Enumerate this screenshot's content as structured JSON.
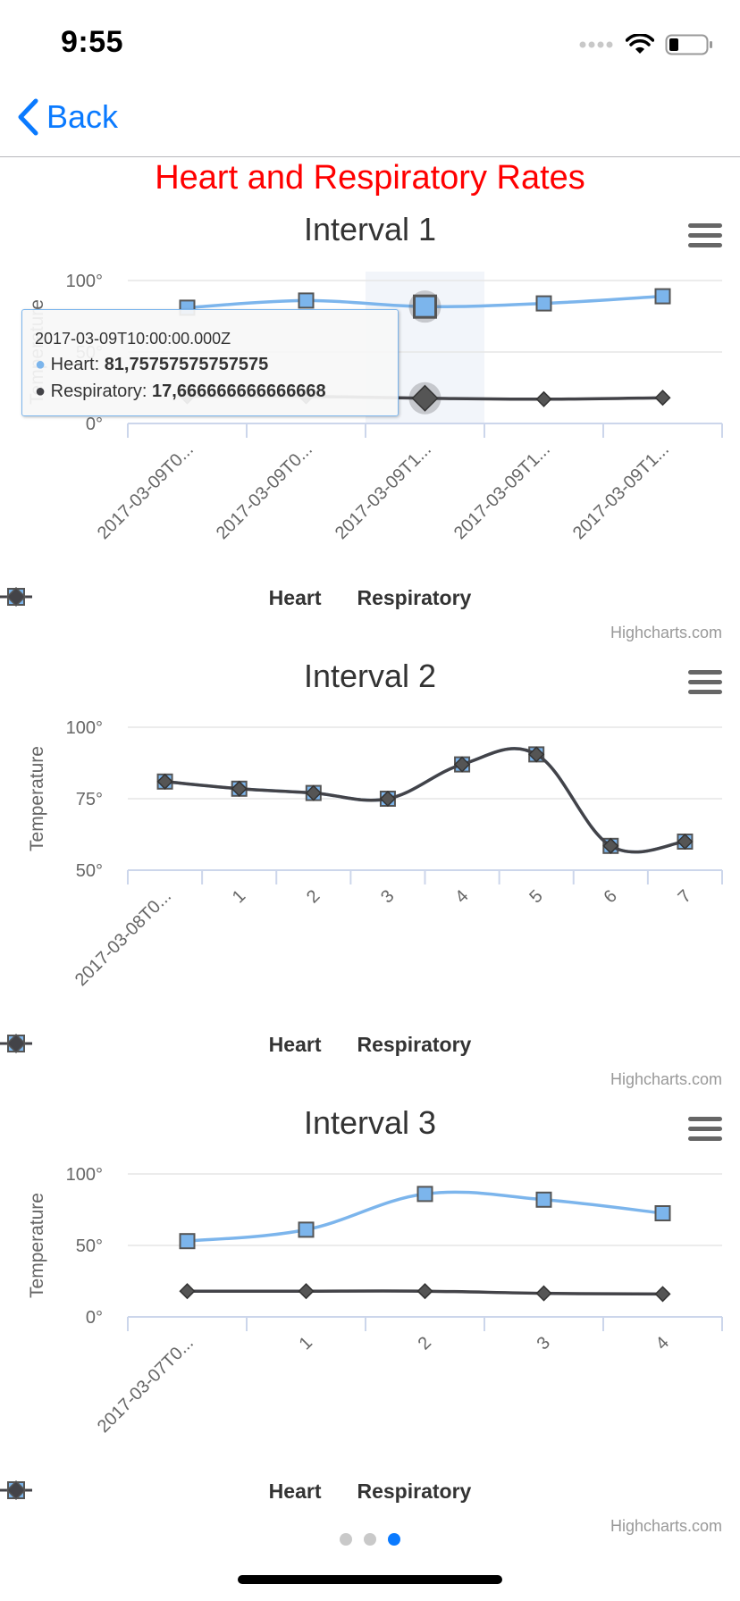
{
  "status": {
    "time": "9:55"
  },
  "nav": {
    "back_label": "Back"
  },
  "page": {
    "title": "Heart and Respiratory Rates",
    "title_color": "#ff0000"
  },
  "colors": {
    "heart": "#7cb5ec",
    "respiratory": "#434348",
    "grid": "#e6e6e6",
    "axis": "#ccd6eb",
    "accent": "#0a7aff"
  },
  "credits": "Highcharts.com",
  "legend": {
    "heart": "Heart",
    "respiratory": "Respiratory"
  },
  "tooltip": {
    "header": "2017-03-09T10:00:00.000Z",
    "heart_label": "Heart: ",
    "heart_value": "81,75757575757575",
    "resp_label": "Respiratory: ",
    "resp_value": "17,666666666666668"
  },
  "pager": {
    "count": 3,
    "active": 2
  },
  "chart_data": [
    {
      "type": "line",
      "title": "Interval 1",
      "ylabel": "Temperature",
      "ylim": [
        0,
        100
      ],
      "yticks": [
        "0°",
        "50°",
        "100°"
      ],
      "categories": [
        "2017-03-09T0...",
        "2017-03-09T0...",
        "2017-03-09T1...",
        "2017-03-09T1...",
        "2017-03-09T1..."
      ],
      "highlight_index": 2,
      "series": [
        {
          "name": "Heart",
          "values": [
            81,
            86,
            81.76,
            84,
            89
          ]
        },
        {
          "name": "Respiratory",
          "values": [
            19,
            19,
            17.67,
            17,
            18
          ]
        }
      ],
      "legend": "bottom-center",
      "grid": true
    },
    {
      "type": "line",
      "title": "Interval 2",
      "ylabel": "Temperature",
      "ylim": [
        50,
        100
      ],
      "yticks": [
        "50°",
        "75°",
        "100°"
      ],
      "categories": [
        "2017-03-08T0...",
        "1",
        "2",
        "3",
        "4",
        "5",
        "6",
        "7"
      ],
      "series": [
        {
          "name": "Heart",
          "values": [
            81,
            78.5,
            77,
            75,
            87,
            90.5,
            58.5,
            60
          ]
        },
        {
          "name": "Respiratory",
          "values": [
            81,
            78.5,
            77,
            75,
            87,
            90.5,
            58.5,
            60
          ]
        }
      ],
      "legend": "bottom-center",
      "grid": true
    },
    {
      "type": "line",
      "title": "Interval 3",
      "ylabel": "Temperature",
      "ylim": [
        0,
        100
      ],
      "yticks": [
        "0°",
        "50°",
        "100°"
      ],
      "categories": [
        "2017-03-07T0...",
        "1",
        "2",
        "3",
        "4"
      ],
      "series": [
        {
          "name": "Heart",
          "values": [
            53,
            61,
            86,
            82,
            72.5
          ]
        },
        {
          "name": "Respiratory",
          "values": [
            18,
            18,
            18,
            16.5,
            16
          ]
        }
      ],
      "legend": "bottom-center",
      "grid": true
    }
  ]
}
